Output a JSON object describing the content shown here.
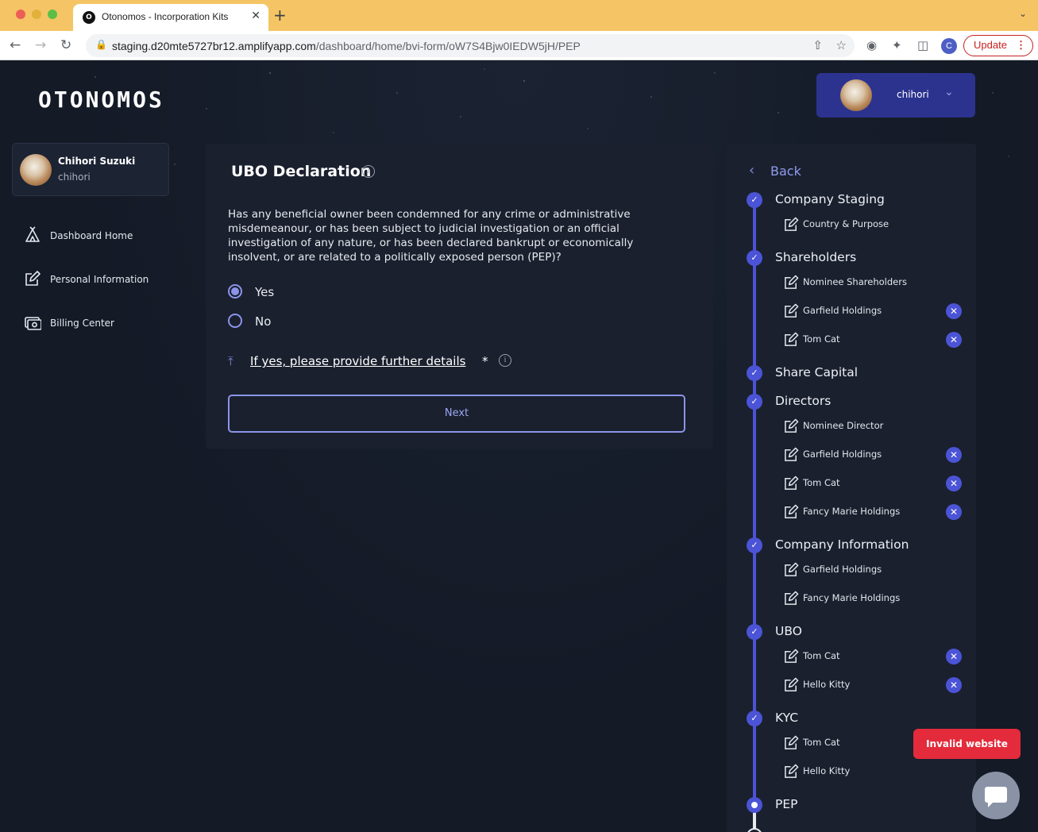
{
  "browser": {
    "tab_title": "Otonomos - Incorporation Kits",
    "tab_favicon": "O",
    "tab_close": "✕",
    "new_tab": "+",
    "url_host": "staging.d20mte5727br12.amplifyapp.com",
    "url_path": "/dashboard/home/bvi-form/oW7S4Bjw0IEDW5jH/PEP",
    "profile_initial": "C",
    "update_label": "Update"
  },
  "app": {
    "logo": "OTONOMOS",
    "user_menu": {
      "username": "chihori"
    },
    "profile": {
      "name": "Chihori Suzuki",
      "username": "chihori"
    },
    "side_nav": [
      {
        "label": "Dashboard Home",
        "icon": "tent-icon"
      },
      {
        "label": "Personal Information",
        "icon": "edit-icon"
      },
      {
        "label": "Billing Center",
        "icon": "camera-money-icon"
      }
    ]
  },
  "form": {
    "title": "UBO Declaration",
    "question": "Has any beneficial owner been condemned for any crime or administrative misdemeanour, or has been subject to judicial investigation or an official investigation of any nature, or has been declared bankrupt or economically insolvent, or are related to a politically exposed person (PEP)?",
    "options": [
      {
        "label": "Yes",
        "checked": true
      },
      {
        "label": "No",
        "checked": false
      }
    ],
    "upload_label": "If yes, please provide further details",
    "required_mark": "*",
    "next_label": "Next"
  },
  "progress": {
    "back_label": "Back",
    "steps": [
      {
        "label": "Company Staging",
        "state": "done",
        "subs": [
          {
            "label": "Country & Purpose",
            "removable": false
          }
        ]
      },
      {
        "label": "Shareholders",
        "state": "done",
        "subs": [
          {
            "label": "Nominee Shareholders",
            "removable": false
          },
          {
            "label": "Garfield Holdings",
            "removable": true
          },
          {
            "label": "Tom Cat",
            "removable": true
          }
        ]
      },
      {
        "label": "Share Capital",
        "state": "done",
        "subs": []
      },
      {
        "label": "Directors",
        "state": "done",
        "subs": [
          {
            "label": "Nominee Director",
            "removable": false
          },
          {
            "label": "Garfield Holdings",
            "removable": true
          },
          {
            "label": "Tom Cat",
            "removable": true
          },
          {
            "label": "Fancy Marie Holdings",
            "removable": true
          }
        ]
      },
      {
        "label": "Company Information",
        "state": "done",
        "subs": [
          {
            "label": "Garfield Holdings",
            "removable": false
          },
          {
            "label": "Fancy Marie Holdings",
            "removable": false
          }
        ]
      },
      {
        "label": "UBO",
        "state": "done",
        "subs": [
          {
            "label": "Tom Cat",
            "removable": true
          },
          {
            "label": "Hello Kitty",
            "removable": true
          }
        ]
      },
      {
        "label": "KYC",
        "state": "done",
        "subs": [
          {
            "label": "Tom Cat",
            "removable": false
          },
          {
            "label": "Hello Kitty",
            "removable": false
          }
        ]
      },
      {
        "label": "PEP",
        "state": "current",
        "subs": []
      }
    ]
  },
  "alerts": {
    "invalid_website": "Invalid website"
  },
  "colors": {
    "accent": "#4b53d6",
    "user_menu_bg": "#2c338f",
    "alert": "#e32b3b",
    "browser_tabbar": "#f5c565"
  }
}
